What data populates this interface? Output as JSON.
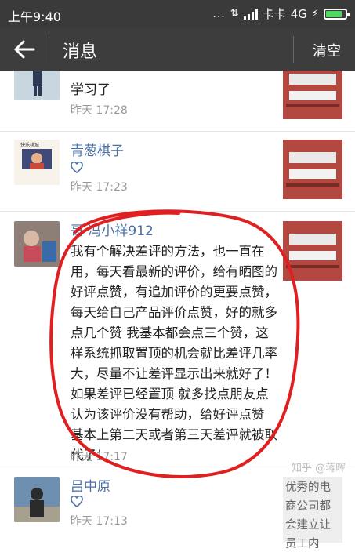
{
  "status_bar": {
    "time": "上午9:40",
    "dots": "...",
    "carrier": "卡卡",
    "network": "4G",
    "battery_level": 0.85,
    "battery_color": "#4cd964"
  },
  "app_bar": {
    "back_icon": "arrow-left-icon",
    "title": "消息",
    "clear_label": "清空"
  },
  "messages": [
    {
      "text": "学习了",
      "time": "昨天 17:28"
    },
    {
      "name": "青葱棋子",
      "time": "昨天 17:23",
      "avatar_caption": "快乐棋城"
    },
    {
      "name": "冯小祥912",
      "name_prefix": "哥",
      "body": "我有个解决差评的方法，也一直在用，每天看最新的评价，给有晒图的好评点赞，有追加评价的更要点赞，每天给自己产品评价点赞，好的就多点几个赞 我基本都会点三个赞，这样系统抓取置顶的机会就比差评几率大，尽量不让差评显示出来就好了！如果差评已经置顶 就多找点朋友点认为该评价没有帮助，给好评点赞 基本上第二天或者第三天差评就被取代了！",
      "time": "昨天 17:17"
    },
    {
      "name": "吕中原",
      "time": "昨天 17:13",
      "thumb_text": "优秀的电商公司都会建立让员工内"
    }
  ],
  "watermark": "知乎 @蒋晖",
  "colors": {
    "annotation_circle": "#e02020",
    "name_link": "#4a6fa5"
  }
}
